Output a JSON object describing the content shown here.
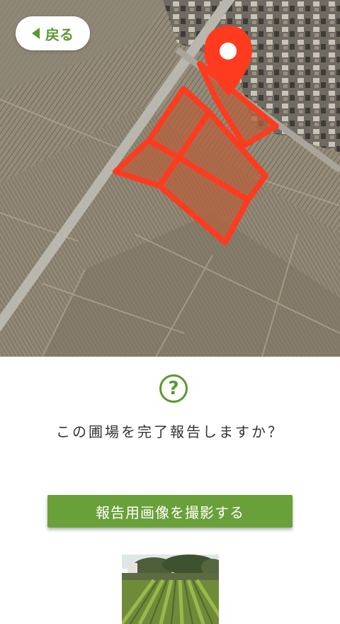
{
  "header": {
    "back_label": "戻る"
  },
  "map": {
    "field_highlight_color": "#ff3b1f",
    "marker_color": "#ff3b1f",
    "marker_icon": "location-pin-icon"
  },
  "dialog": {
    "icon": "question-circle-icon",
    "icon_glyph": "?",
    "question": "この圃場を完了報告しますか？"
  },
  "actions": {
    "capture_label": "報告用画像を撮影する"
  },
  "colors": {
    "accent": "#5a9a30",
    "button": "#6aa03a"
  }
}
